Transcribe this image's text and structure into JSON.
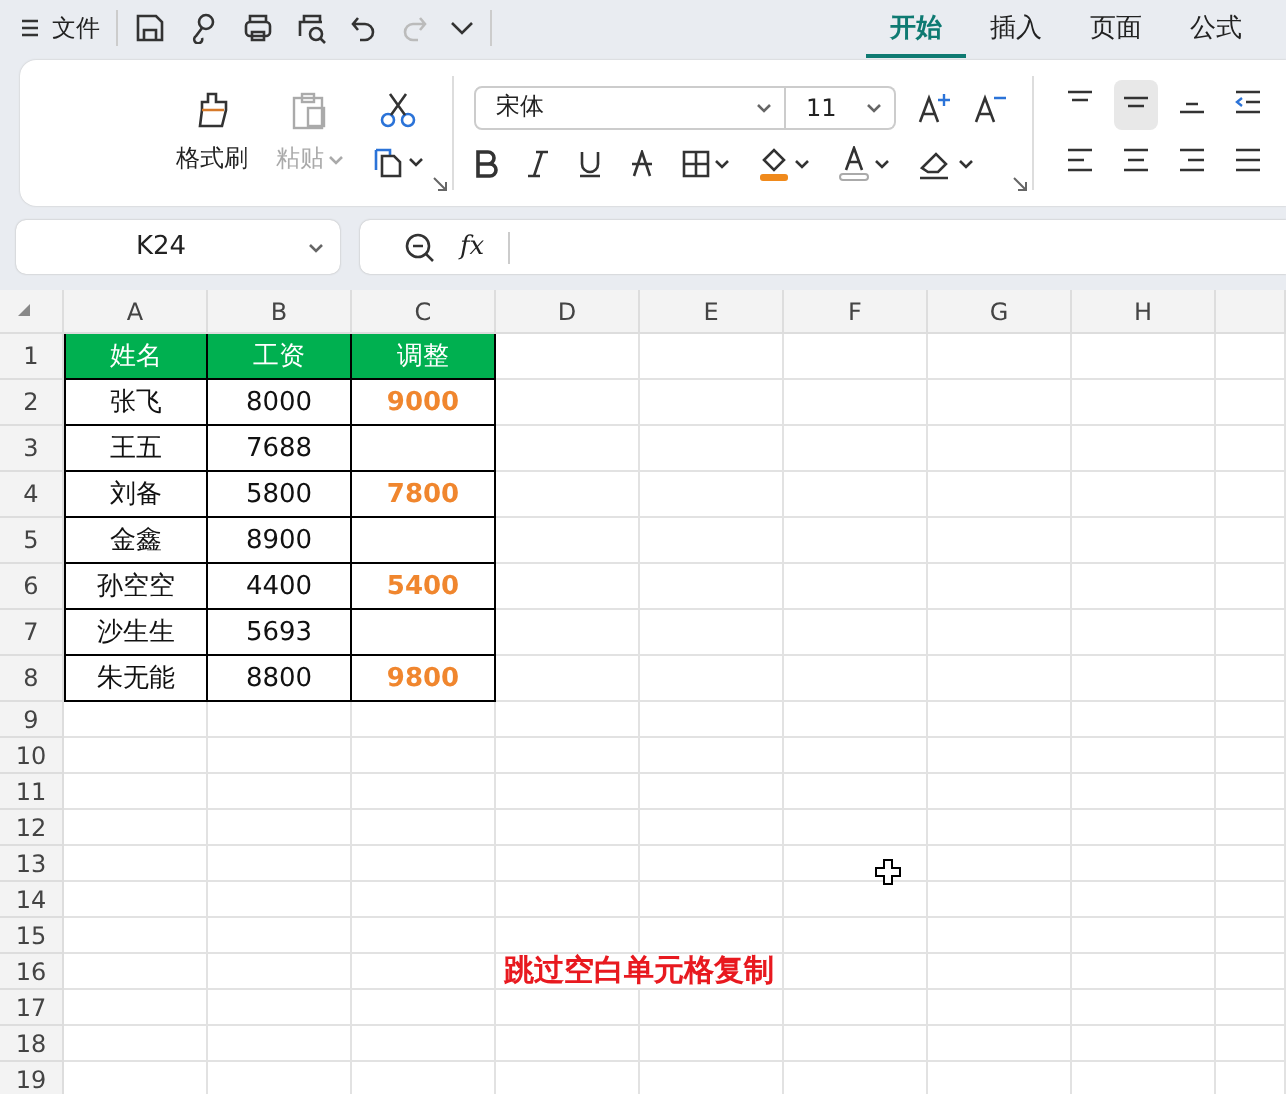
{
  "menu": {
    "label": "文件"
  },
  "tabs": [
    {
      "label": "开始",
      "selected": true
    },
    {
      "label": "插入",
      "selected": false
    },
    {
      "label": "页面",
      "selected": false
    },
    {
      "label": "公式",
      "selected": false
    }
  ],
  "ribbon": {
    "format_painter": {
      "label": "格式刷"
    },
    "paste": {
      "label": "粘贴",
      "disabled": true
    },
    "font": {
      "value": "宋体"
    },
    "size": {
      "value": "11"
    }
  },
  "formula_bar": {
    "name_box": "K24",
    "fx": "fx"
  },
  "sheet": {
    "columns": [
      "A",
      "B",
      "C",
      "D",
      "E",
      "F",
      "G",
      "H"
    ],
    "rows": [
      "1",
      "2",
      "3",
      "4",
      "5",
      "6",
      "7",
      "8",
      "9",
      "10",
      "11",
      "12",
      "13",
      "14",
      "15",
      "16",
      "17",
      "18",
      "19"
    ],
    "table": {
      "columns": [
        "姓名",
        "工资",
        "调整"
      ],
      "rows": [
        {
          "name": "张飞",
          "salary": "8000",
          "adjusted": "9000"
        },
        {
          "name": "王五",
          "salary": "7688"
        },
        {
          "name": "刘备",
          "salary": "5800",
          "adjusted": "7800"
        },
        {
          "name": "金鑫",
          "salary": "8900"
        },
        {
          "name": "孙空空",
          "salary": "4400",
          "adjusted": "5400"
        },
        {
          "name": "沙生生",
          "salary": "5693"
        },
        {
          "name": "朱无能",
          "salary": "8800",
          "adjusted": "9800"
        }
      ]
    },
    "caption": "跳过空白单元格复制"
  }
}
